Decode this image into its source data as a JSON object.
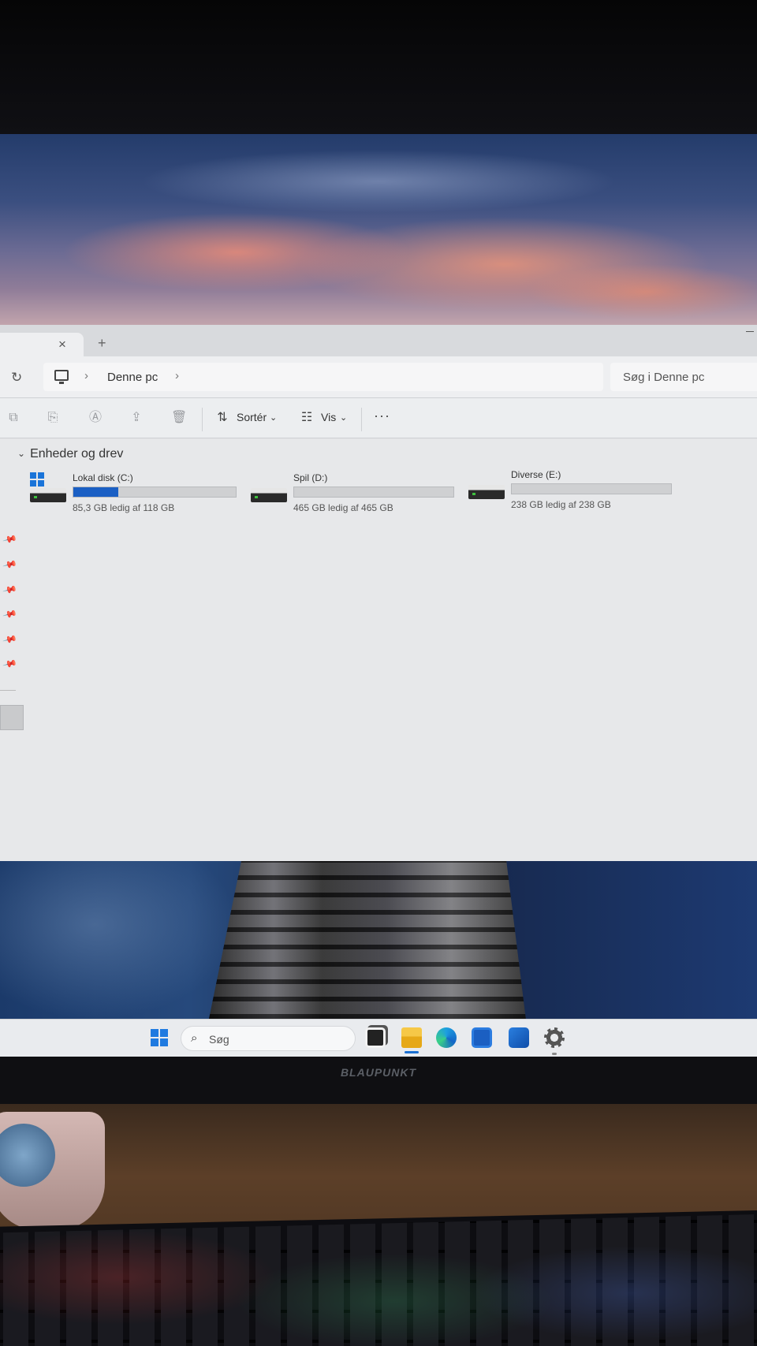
{
  "explorer": {
    "tab": {
      "close_glyph": "×",
      "new_tab_glyph": "+"
    },
    "address": {
      "refresh_glyph": "↻",
      "breadcrumb": "Denne pc",
      "separator": "›"
    },
    "search": {
      "placeholder": "Søg i Denne pc"
    },
    "commands": {
      "cut_icon": "cut-icon",
      "copy_icon": "copy-icon",
      "rename_icon": "rename-icon",
      "share_icon": "share-icon",
      "delete_icon": "delete-icon",
      "sort_label": "Sortér",
      "view_label": "Vis",
      "more_label": "···",
      "dropdown_glyph": "⌄"
    },
    "section": {
      "title": "Enheder og drev",
      "chevron": "⌄"
    },
    "drives": [
      {
        "name": "Lokal disk (C:)",
        "free_text": "85,3 GB ledig af 118 GB",
        "used_fraction": 0.277,
        "system": true
      },
      {
        "name": "Spil (D:)",
        "free_text": "465 GB ledig af 465 GB",
        "used_fraction": 0.0,
        "system": false
      },
      {
        "name": "Diverse (E:)",
        "free_text": "238 GB ledig af 238 GB",
        "used_fraction": 0.0,
        "system": false
      }
    ],
    "pin_glyph": "📌"
  },
  "taskbar": {
    "search_placeholder": "Søg",
    "search_glyph": "⌕",
    "apps": [
      "task-view",
      "file-explorer",
      "edge",
      "microsoft-store",
      "outlook",
      "settings"
    ]
  },
  "monitor": {
    "brand": "BLAUPUNKT"
  },
  "colors": {
    "accent": "#1a5fc4",
    "windows_blue": "#1f7ae0"
  }
}
